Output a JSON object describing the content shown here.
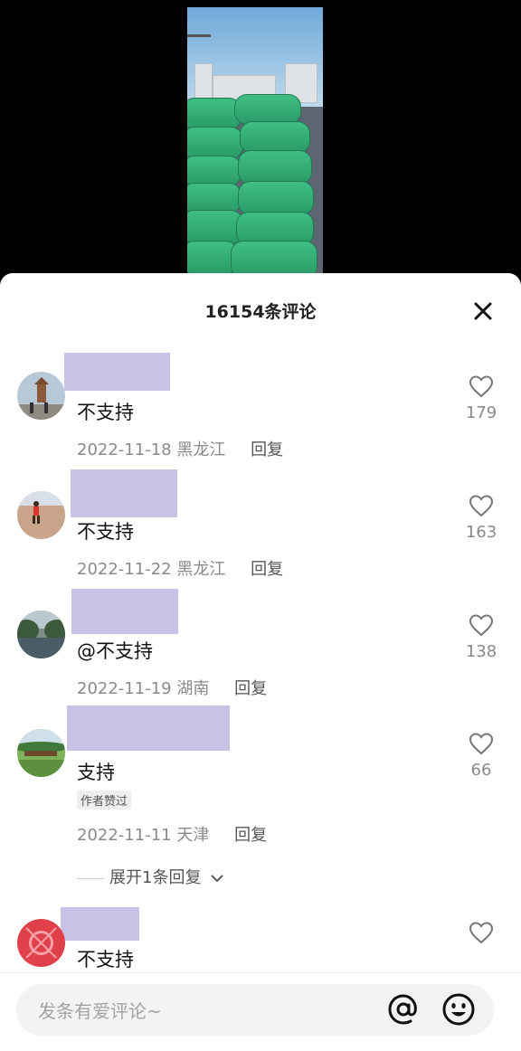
{
  "header": {
    "title": "16154条评论"
  },
  "comments": [
    {
      "text": "不支持",
      "date": "2022-11-18",
      "location": "黑龙江",
      "reply": "回复",
      "likes": "179"
    },
    {
      "text": "不支持",
      "date": "2022-11-22",
      "location": "黑龙江",
      "reply": "回复",
      "likes": "163"
    },
    {
      "text": "@不支持",
      "date": "2022-11-19",
      "location": "湖南",
      "reply": "回复",
      "likes": "138"
    },
    {
      "text": "支持",
      "badge": "作者赞过",
      "date": "2022-11-11",
      "location": "天津",
      "reply": "回复",
      "likes": "66",
      "expand": "展开1条回复"
    },
    {
      "text": "不支持"
    }
  ],
  "input": {
    "placeholder": "发条有爱评论~"
  },
  "icons": {
    "close": "close-icon",
    "like": "heart-icon",
    "mention": "at-icon",
    "emoji": "smile-icon"
  },
  "colors": {
    "name_redaction": "#c9c1e6",
    "meta_text": "#8a8a8a"
  }
}
